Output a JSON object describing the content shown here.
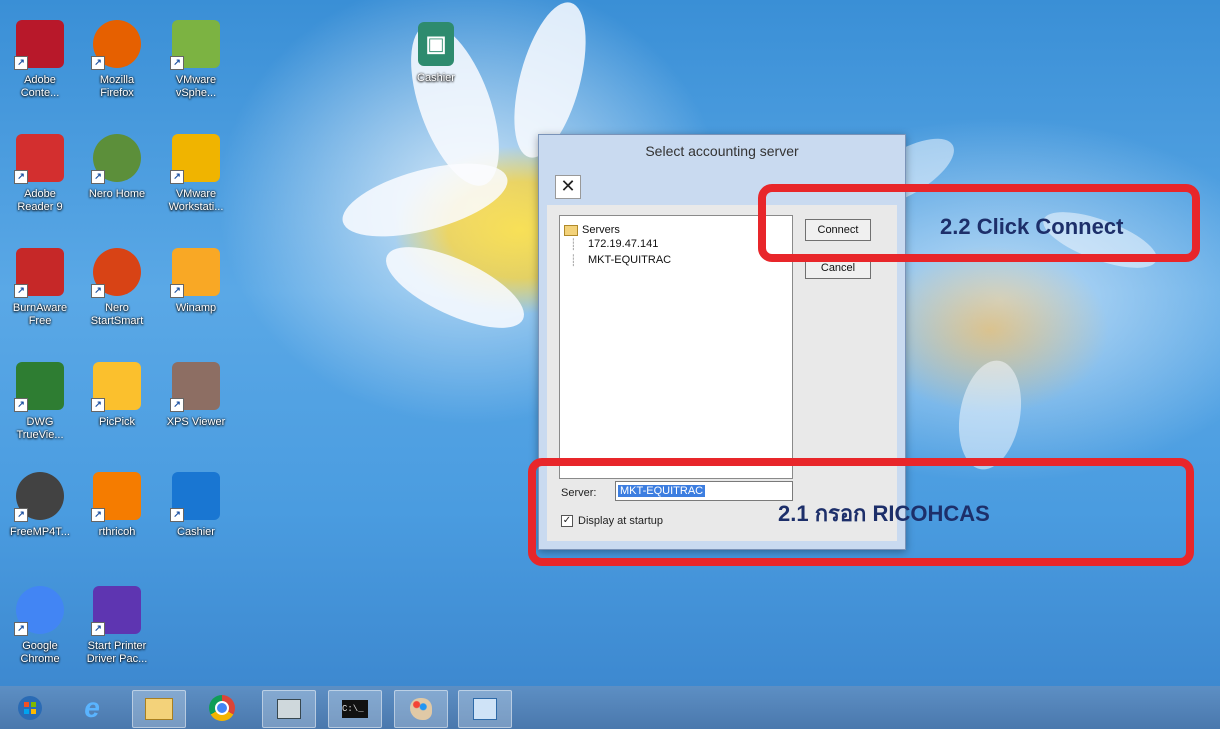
{
  "desktop_icons": [
    {
      "label": "Adobe\nConte...",
      "icon": "adobe-content-icon",
      "color": "#b8182a"
    },
    {
      "label": "Mozilla\nFirefox",
      "icon": "firefox-icon",
      "color": "#e66000"
    },
    {
      "label": "VMware\nvSphe...",
      "icon": "vmware-vsphere-icon",
      "color": "#7cb342"
    },
    {
      "label": "Adobe\nReader 9",
      "icon": "adobe-reader-icon",
      "color": "#d32f2f"
    },
    {
      "label": "Nero Home",
      "icon": "nero-home-icon",
      "color": "#5c8f3a"
    },
    {
      "label": "VMware\nWorkstati...",
      "icon": "vmware-workstation-icon",
      "color": "#f0b400"
    },
    {
      "label": "BurnAware\nFree",
      "icon": "burnaware-icon",
      "color": "#c62828"
    },
    {
      "label": "Nero\nStartSmart",
      "icon": "nero-startsmart-icon",
      "color": "#d84315"
    },
    {
      "label": "Winamp",
      "icon": "winamp-icon",
      "color": "#f9a825"
    },
    {
      "label": "DWG\nTrueVie...",
      "icon": "dwg-trueview-icon",
      "color": "#2e7d32"
    },
    {
      "label": "PicPick",
      "icon": "picpick-icon",
      "color": "#fbc02d"
    },
    {
      "label": "XPS Viewer",
      "icon": "xps-viewer-icon",
      "color": "#8d6e63"
    },
    {
      "label": "FreeMP4T...",
      "icon": "freemp4-icon",
      "color": "#424242"
    },
    {
      "label": "rthricoh",
      "icon": "rthricoh-icon",
      "color": "#f57c00"
    },
    {
      "label": "Cashier",
      "icon": "cashier-icon",
      "color": "#1976d2"
    },
    {
      "label": "Google\nChrome",
      "icon": "chrome-icon",
      "color": "#4285f4"
    },
    {
      "label": "Start Printer\nDriver Pac...",
      "icon": "printer-driver-icon",
      "color": "#5e35b1"
    }
  ],
  "extra_icon": {
    "label": "Cashier",
    "icon": "cashier-icon"
  },
  "dialog": {
    "title": "Select accounting server",
    "close_glyph": "✕",
    "tree_root": "Servers",
    "servers": [
      "172.19.47.141",
      "MKT-EQUITRAC"
    ],
    "connect_label": "Connect",
    "cancel_label": "Cancel",
    "server_label": "Server:",
    "server_value": "MKT-EQUITRAC",
    "checkbox_label": "Display at startup",
    "checkbox_checked": true
  },
  "annotations": {
    "connect_note": "2.2 Click Connect",
    "server_note": "2.1 กรอก RICOHCAS",
    "highlight_color": "#e8262a"
  },
  "taskbar": {
    "items": [
      "windows-start-icon",
      "internet-explorer-icon",
      "file-explorer-icon",
      "chrome-icon",
      "network-icon",
      "cmd-icon",
      "paint-icon",
      "cashier-icon"
    ]
  }
}
